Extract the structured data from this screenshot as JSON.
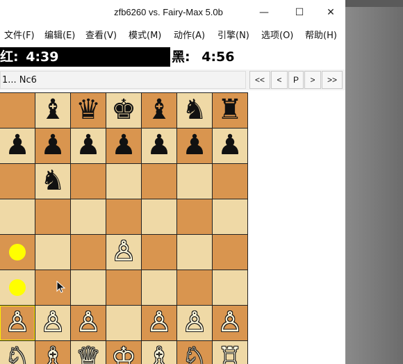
{
  "window": {
    "title": "zfb6260 vs. Fairy-Max 5.0b",
    "controls": {
      "minimize": "—",
      "maximize": "☐",
      "close": "✕"
    }
  },
  "menu": [
    "文件(F)",
    "编辑(E)",
    "查看(V)",
    "模式(M)",
    "动作(A)",
    "引擎(N)",
    "选项(O)",
    "帮助(H)"
  ],
  "clocks": {
    "red_label": "红:",
    "red_time": "4:39",
    "black_label": "黑:",
    "black_time": "4:56"
  },
  "move": {
    "last_move": "1... Nc6",
    "nav": [
      "<<",
      "<",
      "P",
      ">",
      ">>"
    ]
  },
  "board": {
    "rows": [
      [
        {
          "p": "♜",
          "c": "b"
        },
        null,
        {
          "p": "♝",
          "c": "b"
        },
        {
          "p": "♛",
          "c": "b"
        },
        {
          "p": "♚",
          "c": "b"
        },
        {
          "p": "♝",
          "c": "b"
        },
        {
          "p": "♞",
          "c": "b"
        },
        {
          "p": "♜",
          "c": "b"
        }
      ],
      [
        {
          "p": "♟",
          "c": "b"
        },
        {
          "p": "♟",
          "c": "b"
        },
        {
          "p": "♟",
          "c": "b"
        },
        {
          "p": "♟",
          "c": "b"
        },
        {
          "p": "♟",
          "c": "b"
        },
        {
          "p": "♟",
          "c": "b"
        },
        {
          "p": "♟",
          "c": "b"
        },
        {
          "p": "♟",
          "c": "b"
        }
      ],
      [
        null,
        null,
        {
          "p": "♞",
          "c": "b"
        },
        null,
        null,
        null,
        null,
        null
      ],
      [
        null,
        null,
        null,
        null,
        null,
        null,
        null,
        null
      ],
      [
        null,
        null,
        null,
        null,
        {
          "p": "♙",
          "c": "w"
        },
        null,
        null,
        null
      ],
      [
        null,
        null,
        null,
        null,
        null,
        null,
        null,
        null
      ],
      [
        {
          "p": "♙",
          "c": "w"
        },
        {
          "p": "♙",
          "c": "w"
        },
        {
          "p": "♙",
          "c": "w"
        },
        {
          "p": "♙",
          "c": "w"
        },
        null,
        {
          "p": "♙",
          "c": "w"
        },
        {
          "p": "♙",
          "c": "w"
        },
        {
          "p": "♙",
          "c": "w"
        }
      ],
      [
        {
          "p": "♖",
          "c": "w"
        },
        {
          "p": "♘",
          "c": "w"
        },
        {
          "p": "♗",
          "c": "w"
        },
        {
          "p": "♕",
          "c": "w"
        },
        {
          "p": "♔",
          "c": "w"
        },
        {
          "p": "♗",
          "c": "w"
        },
        {
          "p": "♘",
          "c": "w"
        },
        {
          "p": "♖",
          "c": "w"
        }
      ]
    ],
    "move_hint_squares": [
      "b4",
      "b3"
    ],
    "selected_square": "b2",
    "colors": {
      "light": "#efd9a6",
      "dark": "#d9954f",
      "hint": "#ffff00"
    }
  }
}
